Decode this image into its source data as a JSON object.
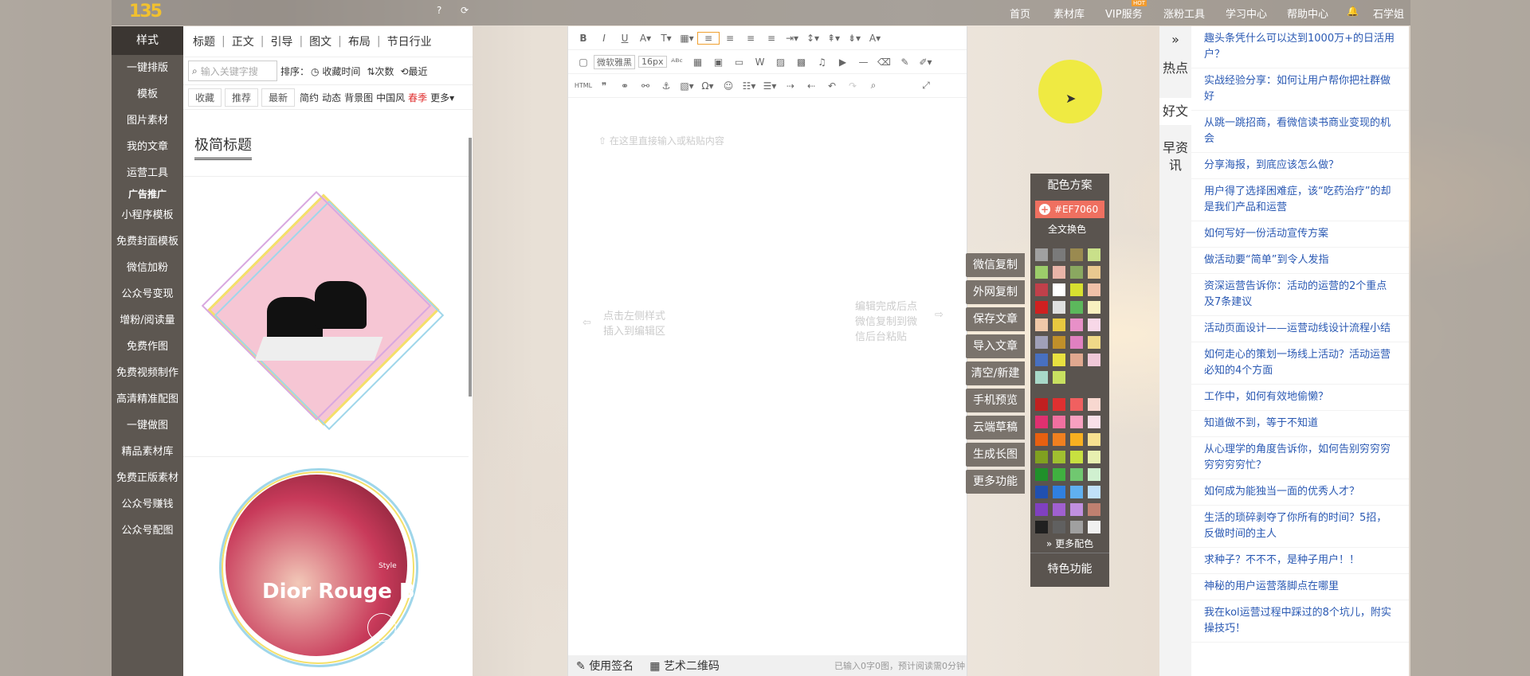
{
  "topbar": {
    "logo_text": "135",
    "nav": [
      "首页",
      "素材库",
      "VIP服务",
      "涨粉工具",
      "学习中心",
      "帮助中心",
      "石学姐"
    ],
    "hot_badge": "HOT"
  },
  "leftmenu": {
    "head": "样式",
    "items": [
      "一键排版",
      "模板",
      "图片素材",
      "我的文章",
      "运营工具",
      "广告推广",
      "小程序模板",
      "免费封面模板",
      "微信加粉",
      "公众号变现",
      "增粉/阅读量",
      "免费作图",
      "免费视频制作",
      "高清精准配图",
      "一键做图",
      "精品素材库",
      "免费正版素材",
      "公众号赚钱",
      "公众号配图"
    ]
  },
  "stylepanel": {
    "tabs": [
      "标题",
      "正文",
      "引导",
      "图文",
      "布局",
      "节日行业"
    ],
    "search_placeholder": "输入关键字搜",
    "sort_label": "排序：",
    "sort_options": [
      "收藏时间",
      "次数",
      "最近"
    ],
    "filter_buttons": [
      "收藏",
      "推荐",
      "最新"
    ],
    "filter_tags": [
      "简约",
      "动态",
      "背景图",
      "中国风",
      "春季",
      "更多"
    ],
    "section_title": "极简标题",
    "card2_text": "Dior Rouge B",
    "card2_style": "Style"
  },
  "editor": {
    "font_name": "微软雅黑",
    "font_size": "16px",
    "placeholder": "在这里直接输入或粘贴内容",
    "hint_left_1": "点击左侧样式",
    "hint_left_2": "插入到编辑区",
    "hint_right_1": "编辑完成后点",
    "hint_right_2": "微信复制到微",
    "hint_right_3": "信后台粘贴",
    "footer_sign": "使用签名",
    "footer_qr": "艺术二维码",
    "footer_count": "已输入0字0图，预计阅读需0分钟"
  },
  "actions": [
    "微信复制",
    "外网复制",
    "保存文章",
    "导入文章",
    "清空/新建",
    "手机预览",
    "云端草稿",
    "生成长图",
    "更多功能"
  ],
  "colorpanel": {
    "title": "配色方案",
    "current": "#EF7060",
    "all_label": "全文换色",
    "more": "更多配色",
    "special": "特色功能",
    "swatches_top": [
      "#a0a0a0",
      "#7a7a7a",
      "#9a8a50",
      "#c9e08a",
      "#9ccc6a",
      "#e8b4a8",
      "#8aa860",
      "#e8c890",
      "#c0404a",
      "#ffffff",
      "#d8e030",
      "#f0c0a8",
      "#d02020",
      "#e0e0e0",
      "#5cb85c",
      "#f8f0c0",
      "#f0c8a8",
      "#e8c840",
      "#e890c8",
      "#f8d8e8",
      "#a0a0b8",
      "#c0902a",
      "#e080c0",
      "#f0d888",
      "#4870c0",
      "#e8e040",
      "#e0a890",
      "#f0c8d8",
      "#a8d8c8",
      "#c8e060"
    ],
    "swatches_bottom": [
      "#c02020",
      "#e03030",
      "#f06060",
      "#f8d8d0",
      "#e03070",
      "#f070a0",
      "#f8a0c0",
      "#f8e0e8",
      "#e86010",
      "#f08020",
      "#f8b020",
      "#f8e090",
      "#80a020",
      "#a0c030",
      "#c8e040",
      "#e8f0b0",
      "#20902a",
      "#40b040",
      "#70c870",
      "#d0f0d0",
      "#2050b0",
      "#3080e0",
      "#60b0f0",
      "#c0e0f8",
      "#8040c0",
      "#a060d0",
      "#c090e0",
      "#c08070",
      "#202020",
      "#606060",
      "#a0a0a0",
      "#f0f0f0"
    ]
  },
  "hot_tabs": [
    "热点",
    "好文",
    "早资讯"
  ],
  "articles": [
    "趣头条凭什么可以达到1000万+的日活用户？",
    "实战经验分享：如何让用户帮你把社群做好",
    "从跳一跳招商，看微信读书商业变现的机会",
    "分享海报，到底应该怎么做？",
    "用户得了选择困难症，该“吃药治疗”的却是我们产品和运营",
    "如何写好一份活动宣传方案",
    "做活动要“简单”到令人发指",
    "资深运营告诉你：活动的运营的2个重点及7条建议",
    "活动页面设计——运营动线设计流程小结",
    "如何走心的策划一场线上活动？活动运营必知的4个方面",
    "工作中，如何有效地偷懒？",
    "知道做不到，等于不知道",
    "从心理学的角度告诉你，如何告别穷穷穷穷穷穷穷忙？",
    "如何成为能独当一面的优秀人才？",
    "生活的琐碎剥夺了你所有的时间？5招，反做时间的主人",
    "求种子？不不不，是种子用户！！",
    "神秘的用户运营落脚点在哪里",
    "我在kol运营过程中踩过的8个坑儿，附实操技巧！"
  ]
}
